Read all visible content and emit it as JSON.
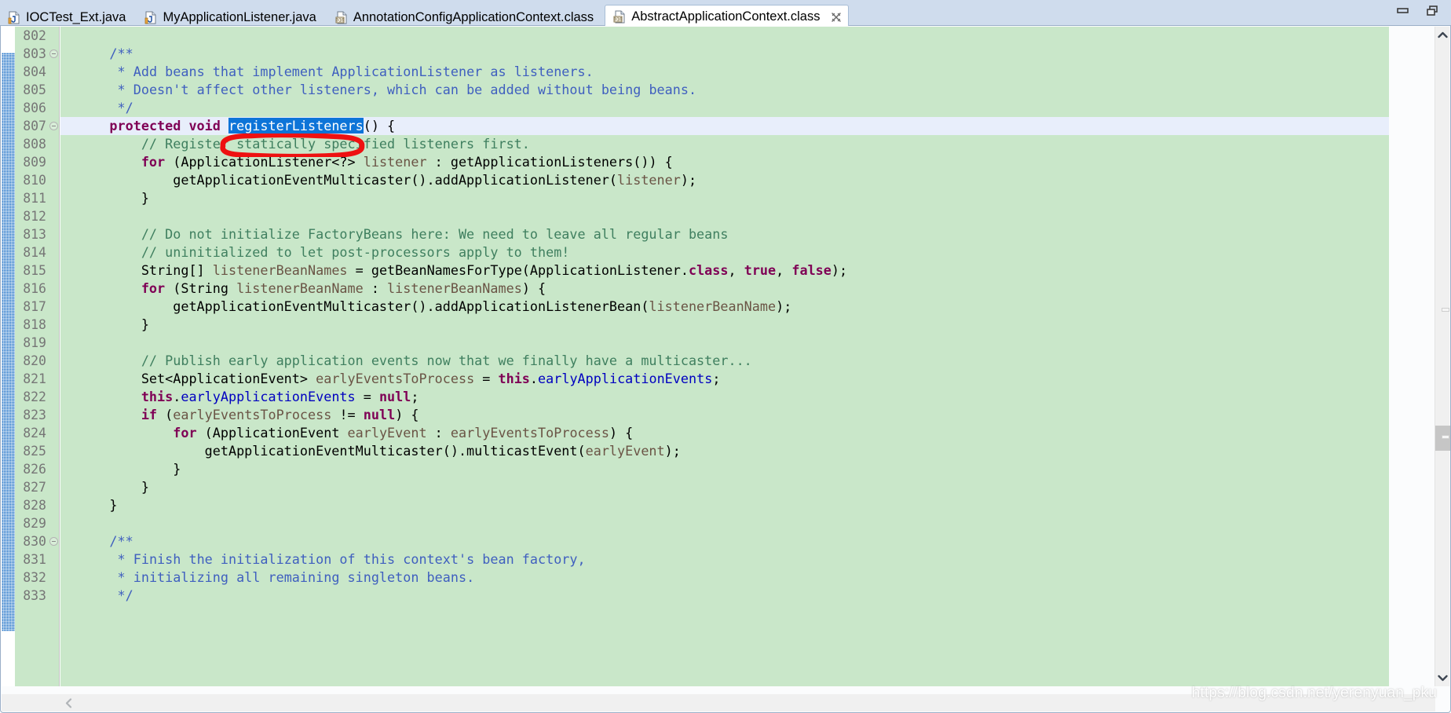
{
  "window": {
    "minimize_label": "Minimize",
    "maximize_label": "Restore",
    "minimize_icon": "minimize-icon",
    "maximize_icon": "restore-icon"
  },
  "tabs": [
    {
      "label": "IOCTest_Ext.java",
      "icon": "java-file-icon",
      "active": false,
      "closable": false
    },
    {
      "label": "MyApplicationListener.java",
      "icon": "java-file-icon",
      "active": false,
      "closable": false
    },
    {
      "label": "AnnotationConfigApplicationContext.class",
      "icon": "class-file-icon",
      "active": false,
      "closable": false
    },
    {
      "label": "AbstractApplicationContext.class",
      "icon": "class-file-icon",
      "active": true,
      "closable": true,
      "close_icon": "close-icon"
    }
  ],
  "editor": {
    "current_line": 807,
    "first_line": 802,
    "last_line": 833,
    "selection_text": "registerListeners",
    "annotation": {
      "shape": "red-oval",
      "color": "#ee1111",
      "target": "registerListeners"
    },
    "colors": {
      "background": "#c9e7c9",
      "current_line": "#e8eefb",
      "gutter_text": "#767676",
      "keyword": "#7f0055",
      "comment": "#3f7f5f",
      "javadoc": "#3f5fbf",
      "local_var": "#6a5445",
      "field": "#0000c0",
      "selection_bg": "#0d74d8",
      "marker_bar": "#1168c4"
    },
    "lines": [
      {
        "num": "802",
        "fold": false,
        "tokens": []
      },
      {
        "num": "803",
        "fold": true,
        "tokens": [
          {
            "t": "    ",
            "c": "t-pl"
          },
          {
            "t": "/**",
            "c": "t-doc"
          }
        ]
      },
      {
        "num": "804",
        "fold": false,
        "tokens": [
          {
            "t": "     ",
            "c": "t-pl"
          },
          {
            "t": "* Add beans that implement ApplicationListener as listeners.",
            "c": "t-doc"
          }
        ]
      },
      {
        "num": "805",
        "fold": false,
        "tokens": [
          {
            "t": "     ",
            "c": "t-pl"
          },
          {
            "t": "* Doesn't affect other listeners, which can be added without being beans.",
            "c": "t-doc"
          }
        ]
      },
      {
        "num": "806",
        "fold": false,
        "tokens": [
          {
            "t": "     ",
            "c": "t-pl"
          },
          {
            "t": "*/",
            "c": "t-doc"
          }
        ]
      },
      {
        "num": "807",
        "fold": true,
        "current": true,
        "tokens": [
          {
            "t": "    ",
            "c": "t-pl"
          },
          {
            "t": "protected void ",
            "c": "t-kw"
          },
          {
            "t": "registerListeners",
            "c": "t-sel"
          },
          {
            "t": "() {",
            "c": "t-pl"
          }
        ]
      },
      {
        "num": "808",
        "fold": false,
        "tokens": [
          {
            "t": "        ",
            "c": "t-pl"
          },
          {
            "t": "// Register statically specified listeners first.",
            "c": "t-cmt"
          }
        ]
      },
      {
        "num": "809",
        "fold": false,
        "tokens": [
          {
            "t": "        ",
            "c": "t-pl"
          },
          {
            "t": "for",
            "c": "t-kw"
          },
          {
            "t": " (ApplicationListener<?> ",
            "c": "t-pl"
          },
          {
            "t": "listener",
            "c": "t-lvar"
          },
          {
            "t": " : getApplicationListeners()) {",
            "c": "t-pl"
          }
        ]
      },
      {
        "num": "810",
        "fold": false,
        "tokens": [
          {
            "t": "            getApplicationEventMulticaster().addApplicationListener(",
            "c": "t-pl"
          },
          {
            "t": "listener",
            "c": "t-lvar"
          },
          {
            "t": ");",
            "c": "t-pl"
          }
        ]
      },
      {
        "num": "811",
        "fold": false,
        "tokens": [
          {
            "t": "        }",
            "c": "t-pl"
          }
        ]
      },
      {
        "num": "812",
        "fold": false,
        "tokens": []
      },
      {
        "num": "813",
        "fold": false,
        "tokens": [
          {
            "t": "        ",
            "c": "t-pl"
          },
          {
            "t": "// Do not initialize FactoryBeans here: We need to leave all regular beans",
            "c": "t-cmt"
          }
        ]
      },
      {
        "num": "814",
        "fold": false,
        "tokens": [
          {
            "t": "        ",
            "c": "t-pl"
          },
          {
            "t": "// uninitialized to let post-processors apply to them!",
            "c": "t-cmt"
          }
        ]
      },
      {
        "num": "815",
        "fold": false,
        "tokens": [
          {
            "t": "        String[] ",
            "c": "t-pl"
          },
          {
            "t": "listenerBeanNames",
            "c": "t-lvar"
          },
          {
            "t": " = getBeanNamesForType(ApplicationListener.",
            "c": "t-pl"
          },
          {
            "t": "class",
            "c": "t-kw"
          },
          {
            "t": ", ",
            "c": "t-pl"
          },
          {
            "t": "true",
            "c": "t-kw"
          },
          {
            "t": ", ",
            "c": "t-pl"
          },
          {
            "t": "false",
            "c": "t-kw"
          },
          {
            "t": ");",
            "c": "t-pl"
          }
        ]
      },
      {
        "num": "816",
        "fold": false,
        "tokens": [
          {
            "t": "        ",
            "c": "t-pl"
          },
          {
            "t": "for",
            "c": "t-kw"
          },
          {
            "t": " (String ",
            "c": "t-pl"
          },
          {
            "t": "listenerBeanName",
            "c": "t-lvar"
          },
          {
            "t": " : ",
            "c": "t-pl"
          },
          {
            "t": "listenerBeanNames",
            "c": "t-lvar"
          },
          {
            "t": ") {",
            "c": "t-pl"
          }
        ]
      },
      {
        "num": "817",
        "fold": false,
        "tokens": [
          {
            "t": "            getApplicationEventMulticaster().addApplicationListenerBean(",
            "c": "t-pl"
          },
          {
            "t": "listenerBeanName",
            "c": "t-lvar"
          },
          {
            "t": ");",
            "c": "t-pl"
          }
        ]
      },
      {
        "num": "818",
        "fold": false,
        "tokens": [
          {
            "t": "        }",
            "c": "t-pl"
          }
        ]
      },
      {
        "num": "819",
        "fold": false,
        "tokens": []
      },
      {
        "num": "820",
        "fold": false,
        "tokens": [
          {
            "t": "        ",
            "c": "t-pl"
          },
          {
            "t": "// Publish early application events now that we finally have a multicaster...",
            "c": "t-cmt"
          }
        ]
      },
      {
        "num": "821",
        "fold": false,
        "tokens": [
          {
            "t": "        Set<ApplicationEvent> ",
            "c": "t-pl"
          },
          {
            "t": "earlyEventsToProcess",
            "c": "t-lvar"
          },
          {
            "t": " = ",
            "c": "t-pl"
          },
          {
            "t": "this",
            "c": "t-kw"
          },
          {
            "t": ".",
            "c": "t-pl"
          },
          {
            "t": "earlyApplicationEvents",
            "c": "t-fld"
          },
          {
            "t": ";",
            "c": "t-pl"
          }
        ]
      },
      {
        "num": "822",
        "fold": false,
        "tokens": [
          {
            "t": "        ",
            "c": "t-pl"
          },
          {
            "t": "this",
            "c": "t-kw"
          },
          {
            "t": ".",
            "c": "t-pl"
          },
          {
            "t": "earlyApplicationEvents",
            "c": "t-fld"
          },
          {
            "t": " = ",
            "c": "t-pl"
          },
          {
            "t": "null",
            "c": "t-kw"
          },
          {
            "t": ";",
            "c": "t-pl"
          }
        ]
      },
      {
        "num": "823",
        "fold": false,
        "tokens": [
          {
            "t": "        ",
            "c": "t-pl"
          },
          {
            "t": "if",
            "c": "t-kw"
          },
          {
            "t": " (",
            "c": "t-pl"
          },
          {
            "t": "earlyEventsToProcess",
            "c": "t-lvar"
          },
          {
            "t": " != ",
            "c": "t-pl"
          },
          {
            "t": "null",
            "c": "t-kw"
          },
          {
            "t": ") {",
            "c": "t-pl"
          }
        ]
      },
      {
        "num": "824",
        "fold": false,
        "tokens": [
          {
            "t": "            ",
            "c": "t-pl"
          },
          {
            "t": "for",
            "c": "t-kw"
          },
          {
            "t": " (ApplicationEvent ",
            "c": "t-pl"
          },
          {
            "t": "earlyEvent",
            "c": "t-lvar"
          },
          {
            "t": " : ",
            "c": "t-pl"
          },
          {
            "t": "earlyEventsToProcess",
            "c": "t-lvar"
          },
          {
            "t": ") {",
            "c": "t-pl"
          }
        ]
      },
      {
        "num": "825",
        "fold": false,
        "tokens": [
          {
            "t": "                getApplicationEventMulticaster().multicastEvent(",
            "c": "t-pl"
          },
          {
            "t": "earlyEvent",
            "c": "t-lvar"
          },
          {
            "t": ");",
            "c": "t-pl"
          }
        ]
      },
      {
        "num": "826",
        "fold": false,
        "tokens": [
          {
            "t": "            }",
            "c": "t-pl"
          }
        ]
      },
      {
        "num": "827",
        "fold": false,
        "tokens": [
          {
            "t": "        }",
            "c": "t-pl"
          }
        ]
      },
      {
        "num": "828",
        "fold": false,
        "tokens": [
          {
            "t": "    }",
            "c": "t-pl"
          }
        ]
      },
      {
        "num": "829",
        "fold": false,
        "tokens": []
      },
      {
        "num": "830",
        "fold": true,
        "tokens": [
          {
            "t": "    ",
            "c": "t-pl"
          },
          {
            "t": "/**",
            "c": "t-doc"
          }
        ]
      },
      {
        "num": "831",
        "fold": false,
        "tokens": [
          {
            "t": "     ",
            "c": "t-pl"
          },
          {
            "t": "* Finish the initialization of this context's bean factory,",
            "c": "t-doc"
          }
        ]
      },
      {
        "num": "832",
        "fold": false,
        "tokens": [
          {
            "t": "     ",
            "c": "t-pl"
          },
          {
            "t": "* initializing all remaining singleton beans.",
            "c": "t-doc"
          }
        ]
      },
      {
        "num": "833",
        "fold": false,
        "tokens": [
          {
            "t": "     ",
            "c": "t-pl"
          },
          {
            "t": "*/",
            "c": "t-doc"
          }
        ]
      }
    ]
  },
  "scrollbars": {
    "vertical": {
      "up_icon": "chevron-up-icon",
      "down_icon": "chevron-down-icon",
      "thumb": "vscroll-thumb"
    },
    "horizontal": {
      "left_icon": "chevron-left-icon"
    }
  },
  "watermark": {
    "text": "https://blog.csdn.net/yerenyuan_pku"
  }
}
